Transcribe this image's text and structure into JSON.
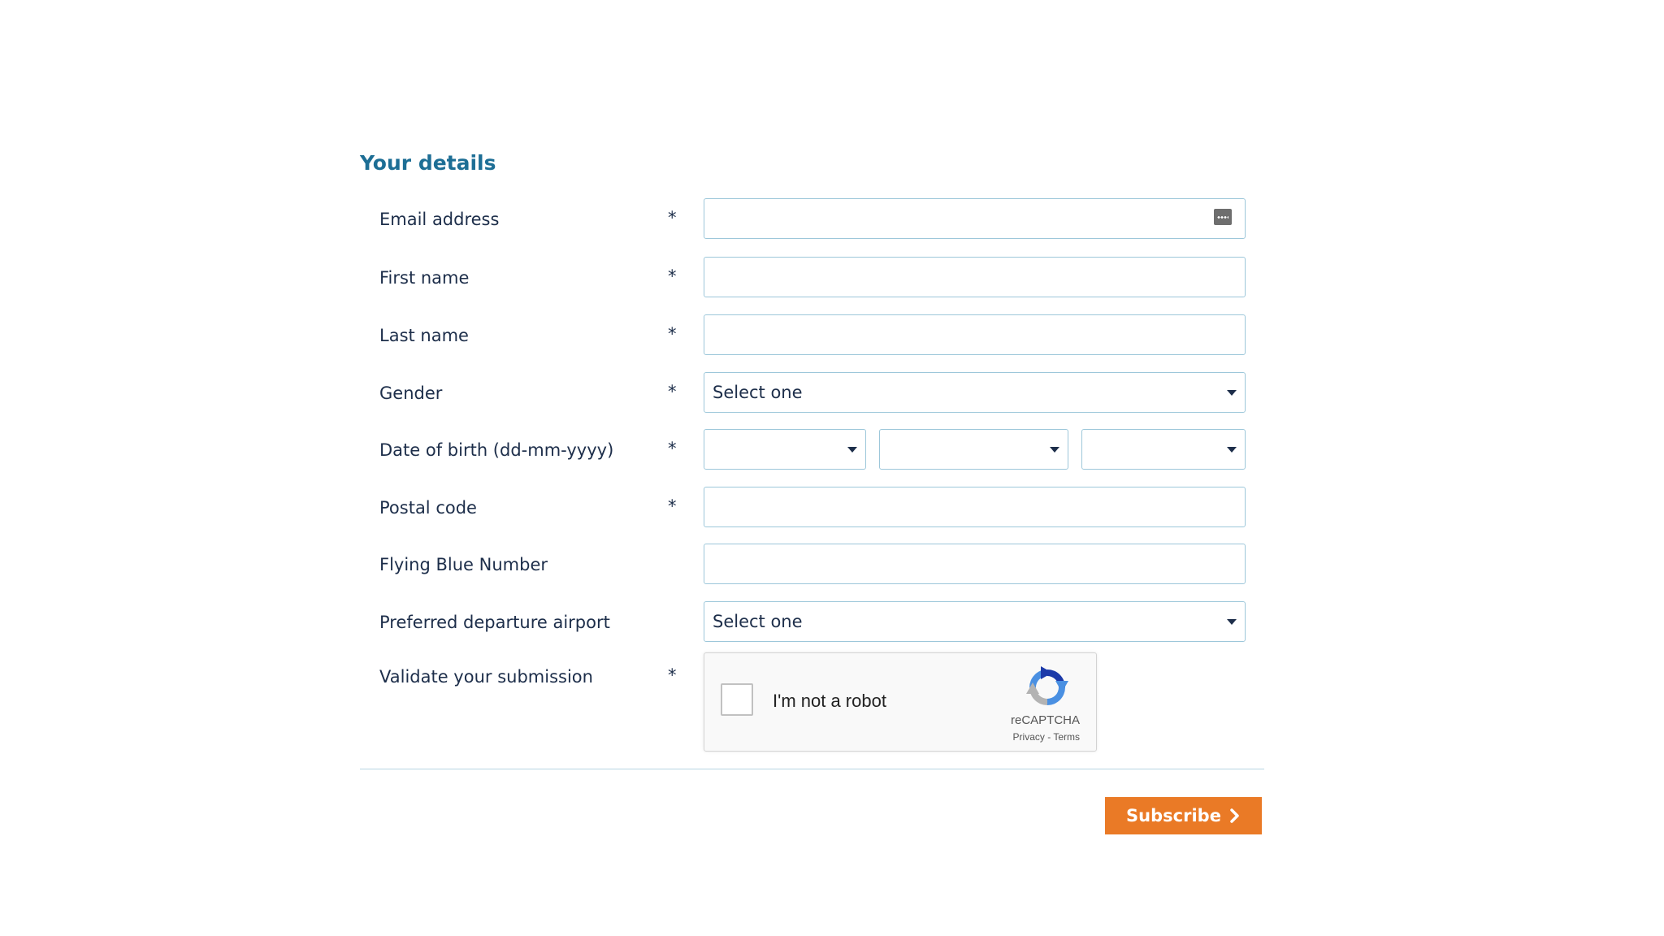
{
  "section": {
    "title": "Your details"
  },
  "required_marker": "*",
  "fields": {
    "email": {
      "label": "Email address",
      "value": "",
      "icon": "password-manager-icon"
    },
    "first_name": {
      "label": "First name",
      "value": ""
    },
    "last_name": {
      "label": "Last name",
      "value": ""
    },
    "gender": {
      "label": "Gender",
      "selected": "Select one"
    },
    "dob": {
      "label": "Date of birth (dd-mm-yyyy)",
      "day": "",
      "month": "",
      "year": ""
    },
    "postal_code": {
      "label": "Postal code",
      "value": ""
    },
    "flying_blue": {
      "label": "Flying Blue Number",
      "value": ""
    },
    "airport": {
      "label": "Preferred departure airport",
      "selected": "Select one"
    },
    "validate": {
      "label": "Validate your submission"
    }
  },
  "recaptcha": {
    "checkbox_label": "I'm not a robot",
    "brand": "reCAPTCHA",
    "privacy": "Privacy",
    "separator": " - ",
    "terms": "Terms"
  },
  "actions": {
    "subscribe_label": "Subscribe"
  },
  "colors": {
    "title": "#1d6e95",
    "field_border": "#9dc7da",
    "button": "#ea7a26"
  }
}
